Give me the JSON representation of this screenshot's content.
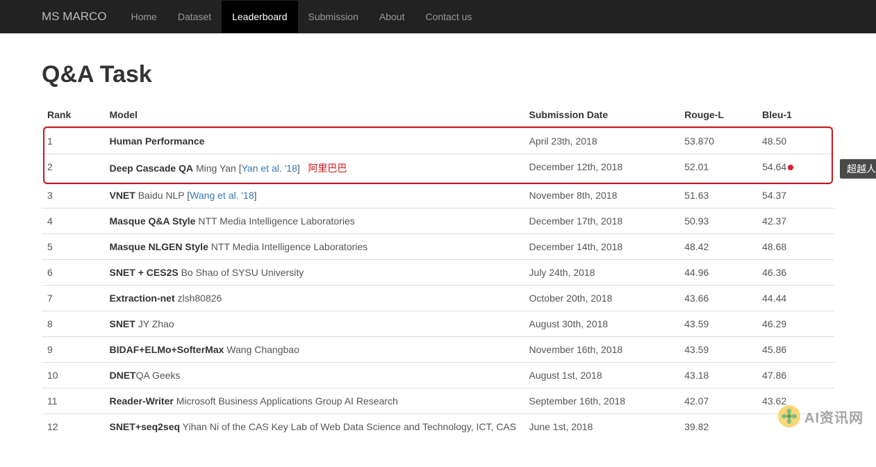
{
  "nav": {
    "brand": "MS MARCO",
    "items": [
      "Home",
      "Dataset",
      "Leaderboard",
      "Submission",
      "About",
      "Contact us"
    ],
    "activeIndex": 2
  },
  "pageTitle": "Q&A Task",
  "headers": {
    "rank": "Rank",
    "model": "Model",
    "date": "Submission Date",
    "rouge": "Rouge-L",
    "bleu": "Bleu-1"
  },
  "callout": "超越人类",
  "watermark": "AI资讯网",
  "highlightRange": [
    0,
    1
  ],
  "rows": [
    {
      "rank": "1",
      "modelName": "Human Performance",
      "modelExtra": "",
      "ref": "",
      "red": "",
      "date": "April 23th, 2018",
      "dateLink": false,
      "rouge": "53.870",
      "bleu": "48.50",
      "bleuDot": false
    },
    {
      "rank": "2",
      "modelName": "Deep Cascade QA",
      "modelExtra": " Ming Yan [",
      "ref": "Yan et al. '18",
      "refClose": "]",
      "red": "阿里巴巴",
      "date": "December 12th, 2018",
      "dateLink": true,
      "rouge": "52.01",
      "bleu": "54.64",
      "bleuDot": true
    },
    {
      "rank": "3",
      "modelName": "VNET",
      "modelExtra": " Baidu NLP [",
      "ref": "Wang et al. '18",
      "refClose": "]",
      "red": "",
      "date": "November 8th, 2018",
      "dateLink": true,
      "rouge": "51.63",
      "bleu": "54.37",
      "bleuDot": false
    },
    {
      "rank": "4",
      "modelName": "Masque Q&A Style",
      "modelExtra": " NTT Media Intelligence Laboratories",
      "ref": "",
      "red": "",
      "date": "December 17th, 2018",
      "dateLink": true,
      "rouge": "50.93",
      "bleu": "42.37",
      "bleuDot": false
    },
    {
      "rank": "5",
      "modelName": "Masque NLGEN Style",
      "modelExtra": " NTT Media Intelligence Laboratories",
      "ref": "",
      "red": "",
      "date": "December 14th, 2018",
      "dateLink": true,
      "rouge": "48.42",
      "bleu": "48.68",
      "bleuDot": false
    },
    {
      "rank": "6",
      "modelName": "SNET + CES2S",
      "modelExtra": " Bo Shao of SYSU University",
      "ref": "",
      "red": "",
      "date": "July 24th, 2018",
      "dateLink": true,
      "rouge": "44.96",
      "bleu": "46.36",
      "bleuDot": false
    },
    {
      "rank": "7",
      "modelName": "Extraction-net",
      "modelExtra": " zlsh80826",
      "ref": "",
      "red": "",
      "date": "October 20th, 2018",
      "dateLink": true,
      "rouge": "43.66",
      "bleu": "44.44",
      "bleuDot": false
    },
    {
      "rank": "8",
      "modelName": "SNET",
      "modelExtra": " JY Zhao",
      "ref": "",
      "red": "",
      "date": "August 30th, 2018",
      "dateLink": true,
      "rouge": "43.59",
      "bleu": "46.29",
      "bleuDot": false
    },
    {
      "rank": "9",
      "modelName": "BIDAF+ELMo+SofterMax",
      "modelExtra": " Wang Changbao",
      "ref": "",
      "red": "",
      "date": "November 16th, 2018",
      "dateLink": true,
      "rouge": "43.59",
      "bleu": "45.86",
      "bleuDot": false
    },
    {
      "rank": "10",
      "modelName": "DNET",
      "modelExtra": "QA Geeks",
      "ref": "",
      "red": "",
      "date": "August 1st, 2018",
      "dateLink": true,
      "rouge": "43.18",
      "bleu": "47.86",
      "bleuDot": false
    },
    {
      "rank": "11",
      "modelName": "Reader-Writer",
      "modelExtra": " Microsoft Business Applications Group AI Research",
      "ref": "",
      "red": "",
      "date": "September 16th, 2018",
      "dateLink": true,
      "rouge": "42.07",
      "bleu": "43.62",
      "bleuDot": false
    },
    {
      "rank": "12",
      "modelName": "SNET+seq2seq",
      "modelExtra": " Yihan Ni of the CAS Key Lab of Web Data Science and Technology, ICT, CAS",
      "ref": "",
      "red": "",
      "date": "June 1st, 2018",
      "dateLink": true,
      "rouge": "39.82",
      "bleu": "",
      "bleuDot": false
    }
  ]
}
